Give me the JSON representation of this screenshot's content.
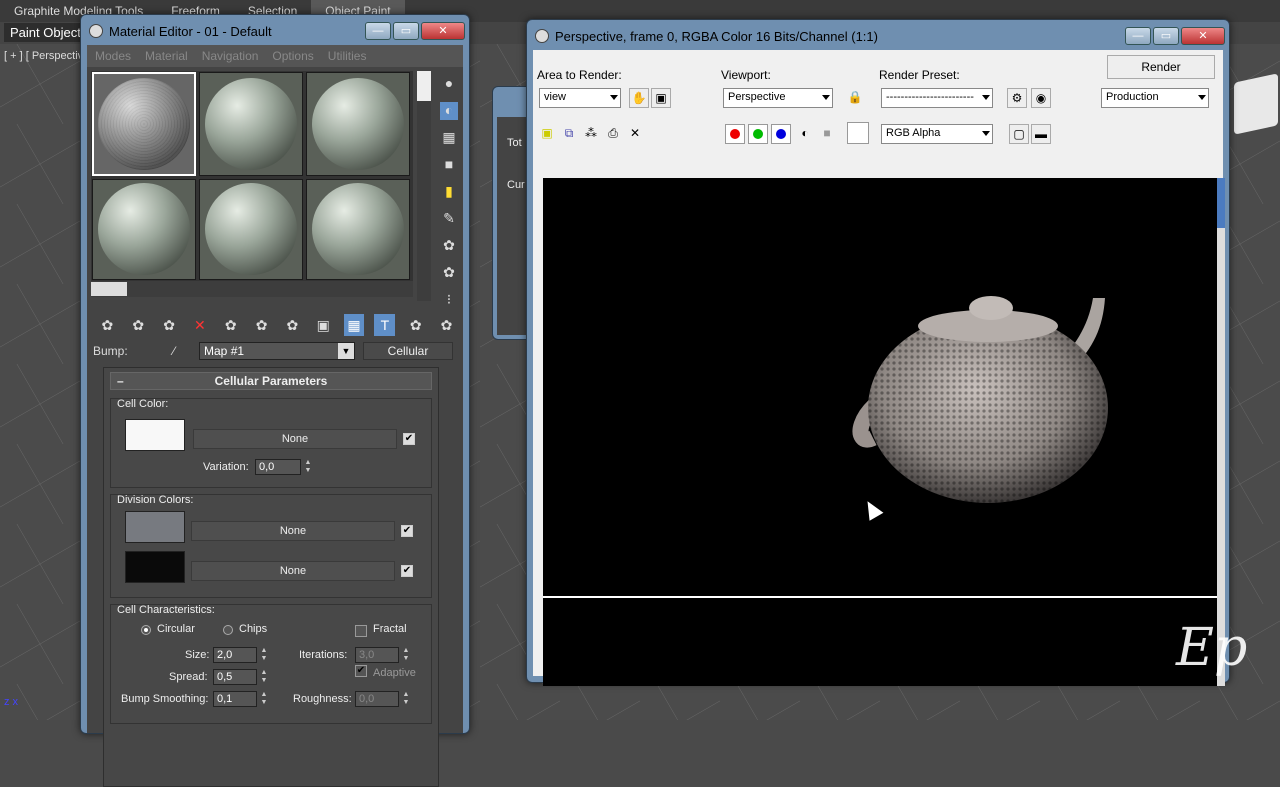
{
  "app_tabs": [
    "Graphite Modeling Tools",
    "Freeform",
    "Selection",
    "Object Paint"
  ],
  "paint_object": "Paint Object",
  "viewport_label": "[ + ] [ Perspective",
  "material_editor": {
    "title": "Material Editor - 01 - Default",
    "menus": [
      "Modes",
      "Material",
      "Navigation",
      "Options",
      "Utilities"
    ],
    "bump_label": "Bump:",
    "map_name": "Map #1",
    "map_type": "Cellular",
    "rollout_title": "Cellular Parameters",
    "cell_color_label": "Cell Color:",
    "cell_color_map": "None",
    "variation_label": "Variation:",
    "variation_value": "0,0",
    "division_colors_label": "Division Colors:",
    "division_map_1": "None",
    "division_map_2": "None",
    "cell_characteristics_label": "Cell Characteristics:",
    "circular_label": "Circular",
    "chips_label": "Chips",
    "fractal_label": "Fractal",
    "size_label": "Size:",
    "size_value": "2,0",
    "iterations_label": "Iterations:",
    "iterations_value": "3,0",
    "spread_label": "Spread:",
    "spread_value": "0,5",
    "adaptive_label": "Adaptive",
    "bump_smoothing_label": "Bump Smoothing:",
    "bump_smoothing_value": "0,1",
    "roughness_label": "Roughness:",
    "roughness_value": "0,0"
  },
  "render_window": {
    "title": "Perspective, frame 0, RGBA Color 16 Bits/Channel (1:1)",
    "area_to_render_label": "Area to Render:",
    "area_to_render_value": "view",
    "viewport_label": "Viewport:",
    "viewport_value": "Perspective",
    "render_preset_label": "Render Preset:",
    "render_preset_value": "------------------------",
    "render_button": "Render",
    "production_value": "Production",
    "channel_value": "RGB Alpha"
  },
  "behind_dialog": {
    "total_label": "Tot",
    "current_label": "Cur"
  },
  "colors": {
    "accent": "#5f8fc8",
    "titlebar": "#6f8fb0"
  }
}
